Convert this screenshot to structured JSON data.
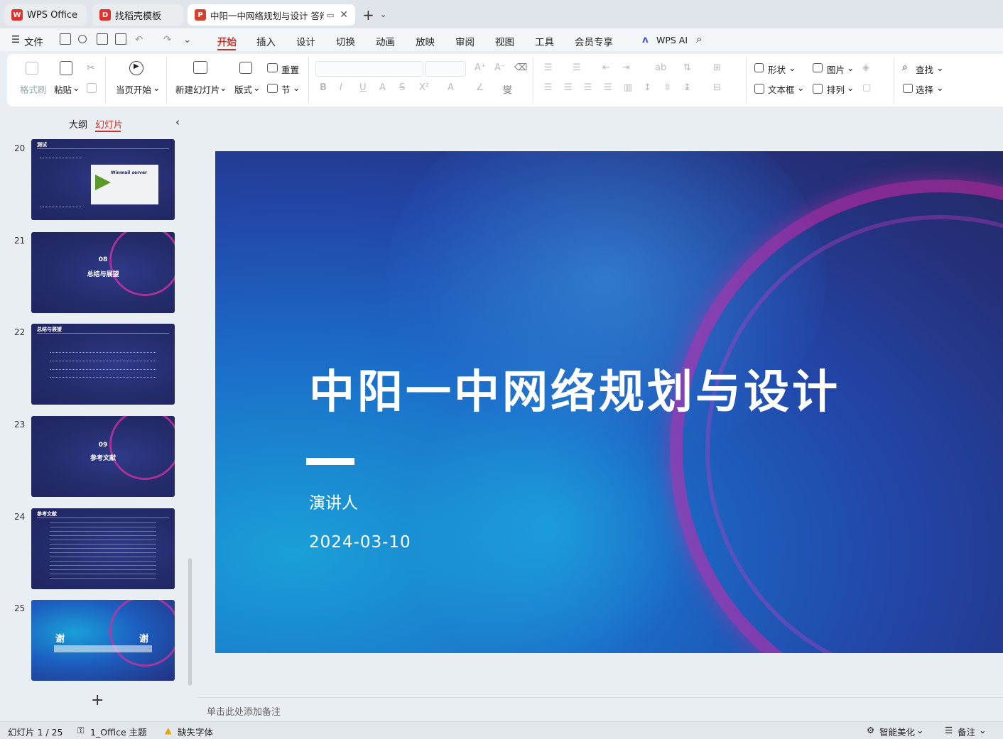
{
  "tabs": [
    {
      "label": "WPS Office",
      "logo": "W",
      "color": "#e0312f"
    },
    {
      "label": "找稻壳模板",
      "logo": "D",
      "color": "#e0312f"
    },
    {
      "label": "中阳一中网络规划与设计 答辩",
      "logo": "P",
      "color": "#d2412b"
    }
  ],
  "menu": {
    "file": "文件",
    "items": [
      "开始",
      "插入",
      "设计",
      "切换",
      "动画",
      "放映",
      "审阅",
      "视图",
      "工具",
      "会员专享"
    ],
    "ai": "WPS AI"
  },
  "ribbon": {
    "format_painter": "格式刷",
    "paste": "粘贴",
    "from_current": "当页开始",
    "new_slide": "新建幻灯片",
    "layout": "版式",
    "reset": "重置",
    "section": "节",
    "shape": "形状",
    "image": "图片",
    "textbox": "文本框",
    "arrange": "排列",
    "find": "查找",
    "select": "选择"
  },
  "panel": {
    "outline": "大纲",
    "slides": "幻灯片"
  },
  "thumbnails": [
    {
      "num": "20",
      "header": "测试",
      "winmail": "Winmail server"
    },
    {
      "num": "21",
      "no": "08",
      "title": "总结与展望"
    },
    {
      "num": "22",
      "header": "总结与展望"
    },
    {
      "num": "23",
      "no": "09",
      "title": "参考文献"
    },
    {
      "num": "24",
      "header": "参考文献"
    },
    {
      "num": "25",
      "left": "谢",
      "right": "谢"
    }
  ],
  "slide": {
    "title": "中阳一中网络规划与设计",
    "speaker": "演讲人",
    "date": "2024-03-10"
  },
  "notes_placeholder": "单击此处添加备注",
  "status": {
    "slide_count": "幻灯片 1 / 25",
    "theme": "1_Office 主题",
    "missing_font": "缺失字体",
    "beautify": "智能美化",
    "notes": "备注"
  }
}
